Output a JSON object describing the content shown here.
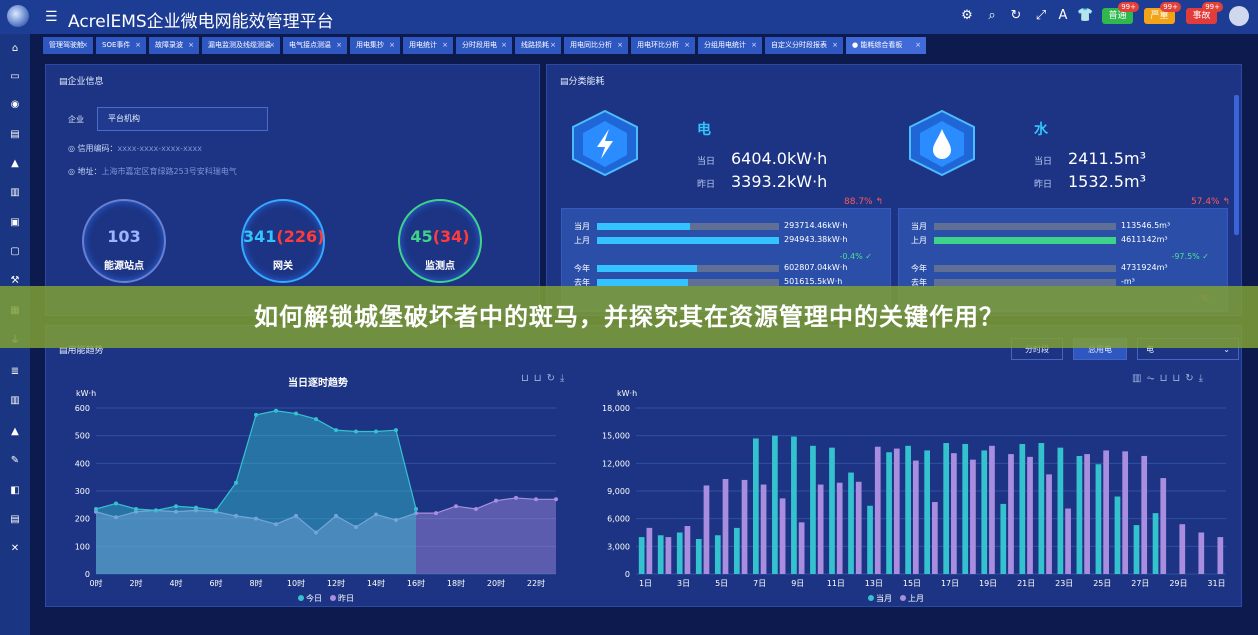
{
  "app": {
    "title": "AcrelEMS企业微电网能效管理平台"
  },
  "header": {
    "badges": [
      {
        "label": "普通",
        "count": "99+",
        "color": "#2eb84d"
      },
      {
        "label": "严重",
        "count": "99+",
        "color": "#f2a318"
      },
      {
        "label": "事故",
        "count": "99+",
        "color": "#e23b3b"
      }
    ],
    "icons": [
      "settings-icon",
      "search-icon",
      "refresh-icon",
      "fullscreen-icon",
      "translate-icon",
      "theme-icon"
    ]
  },
  "tabs": [
    "管理驾驶舱",
    "SOE事件",
    "故障录波",
    "漏电监测及线缆测温",
    "电气接点测温",
    "用电集抄",
    "用电统计",
    "分时段用电",
    "线路损耗",
    "用电同比分析",
    "用电环比分析",
    "分组用电统计",
    "自定义分时段报表",
    "能耗综合看板"
  ],
  "enterprise": {
    "title": "企业信息",
    "company_label": "企业",
    "company_value": "平台机构",
    "credit_label": "信用编码：",
    "credit_value": "xxxx-xxxx-xxxx-xxxx",
    "address_label": "地址：",
    "address_value": "上海市嘉定区育绿路253号安科瑞电气",
    "gauges": [
      {
        "value": "103",
        "extra": "",
        "name": "能源站点",
        "color": "#9fb4ff"
      },
      {
        "value": "341",
        "extra": "(226)",
        "name": "网关",
        "color": "#34c3ff"
      },
      {
        "value": "45",
        "extra": "(34)",
        "name": "监测点",
        "color": "#3fd389"
      }
    ]
  },
  "energy": {
    "title": "分类能耗",
    "electric": {
      "name": "电",
      "today_label": "当日",
      "today": "6404.0kW·h",
      "yesterday_label": "昨日",
      "yesterday": "3393.2kW·h",
      "change": "88.7%",
      "rows": [
        {
          "label": "当月",
          "value": "293714.46kW·h",
          "fraction": 0.51
        },
        {
          "label": "上月",
          "value": "294943.38kW·h",
          "fraction": 1.0
        },
        {
          "label": "今年",
          "value": "602807.04kW·h",
          "fraction": 0.55
        },
        {
          "label": "去年",
          "value": "501615.5kW·h",
          "fraction": 0.5
        }
      ],
      "month_change": "-0.4%",
      "year_change": ""
    },
    "water": {
      "name": "水",
      "today_label": "当日",
      "today": "2411.5m³",
      "yesterday_label": "昨日",
      "yesterday": "1532.5m³",
      "change": "57.4%",
      "rows": [
        {
          "label": "当月",
          "value": "113546.5m³",
          "fraction": 0.02
        },
        {
          "label": "上月",
          "value": "4611142m³",
          "fraction": 1.0
        },
        {
          "label": "今年",
          "value": "4731924m³",
          "fraction": 0.0
        },
        {
          "label": "去年",
          "value": "-m³",
          "fraction": 0.0
        }
      ],
      "month_change": "-97.5%",
      "year_change": "-%"
    }
  },
  "usage": {
    "title": "用能趋势",
    "btn_period": "分时段",
    "btn_total": "总用电",
    "select": "电"
  },
  "overlay": {
    "text": "如何解锁城堡破坏者中的斑马，并探究其在资源管理中的关键作用？"
  },
  "chart_data": [
    {
      "type": "area",
      "title": "当日逐时趋势",
      "ylabel": "kW·h",
      "ylim": [
        0,
        600
      ],
      "x": [
        "0时",
        "1时",
        "2时",
        "3时",
        "4时",
        "5时",
        "6时",
        "7时",
        "8时",
        "9时",
        "10时",
        "11时",
        "12时",
        "13时",
        "14时",
        "15时",
        "16时",
        "17时",
        "18时",
        "19时",
        "20时",
        "21时",
        "22时",
        "23时"
      ],
      "xticks": [
        "0时",
        "2时",
        "4时",
        "6时",
        "8时",
        "10时",
        "12时",
        "14时",
        "16时",
        "18时",
        "20时",
        "22时"
      ],
      "yticks": [
        "0",
        "100",
        "200",
        "300",
        "400",
        "500",
        "600"
      ],
      "series": [
        {
          "name": "今日",
          "color": "#35c2cf",
          "values": [
            235,
            255,
            235,
            230,
            245,
            240,
            230,
            330,
            575,
            590,
            580,
            560,
            520,
            515,
            515,
            520,
            235,
            null,
            null,
            null,
            null,
            null,
            null,
            null
          ]
        },
        {
          "name": "昨日",
          "color": "#a98ee0",
          "values": [
            225,
            205,
            225,
            230,
            225,
            230,
            225,
            210,
            200,
            180,
            210,
            150,
            210,
            170,
            215,
            195,
            220,
            220,
            245,
            235,
            265,
            275,
            270,
            270
          ]
        }
      ]
    },
    {
      "type": "bar",
      "title": "",
      "ylabel": "kW·h",
      "ylim": [
        0,
        18000
      ],
      "categories": [
        "1日",
        "2日",
        "3日",
        "4日",
        "5日",
        "6日",
        "7日",
        "8日",
        "9日",
        "10日",
        "11日",
        "12日",
        "13日",
        "14日",
        "15日",
        "16日",
        "17日",
        "18日",
        "19日",
        "20日",
        "21日",
        "22日",
        "23日",
        "24日",
        "25日",
        "26日",
        "27日",
        "28日",
        "29日",
        "30日",
        "31日"
      ],
      "xticks": [
        "1日",
        "3日",
        "5日",
        "7日",
        "9日",
        "11日",
        "13日",
        "15日",
        "17日",
        "19日",
        "21日",
        "23日",
        "25日",
        "27日",
        "29日",
        "31日"
      ],
      "yticks": [
        "0",
        "3,000",
        "6,000",
        "9,000",
        "12,000",
        "15,000",
        "18,000"
      ],
      "series": [
        {
          "name": "当月",
          "color": "#35c2cf",
          "values": [
            4000,
            4200,
            4500,
            3800,
            4200,
            5000,
            14700,
            15000,
            14900,
            13900,
            13700,
            11000,
            7400,
            13200,
            13900,
            13400,
            14200,
            14100,
            13400,
            7600,
            14100,
            14200,
            13700,
            12800,
            11900,
            8400,
            5300,
            6600,
            null,
            null,
            null
          ]
        },
        {
          "name": "上月",
          "color": "#a98ee0",
          "values": [
            5000,
            4000,
            5200,
            9600,
            10300,
            10200,
            9700,
            8200,
            5600,
            9700,
            9900,
            10000,
            13800,
            13600,
            12300,
            7800,
            13100,
            12400,
            13900,
            13000,
            12700,
            10800,
            7100,
            13000,
            13400,
            13300,
            12800,
            10400,
            5400,
            4500,
            4000
          ]
        }
      ]
    }
  ]
}
